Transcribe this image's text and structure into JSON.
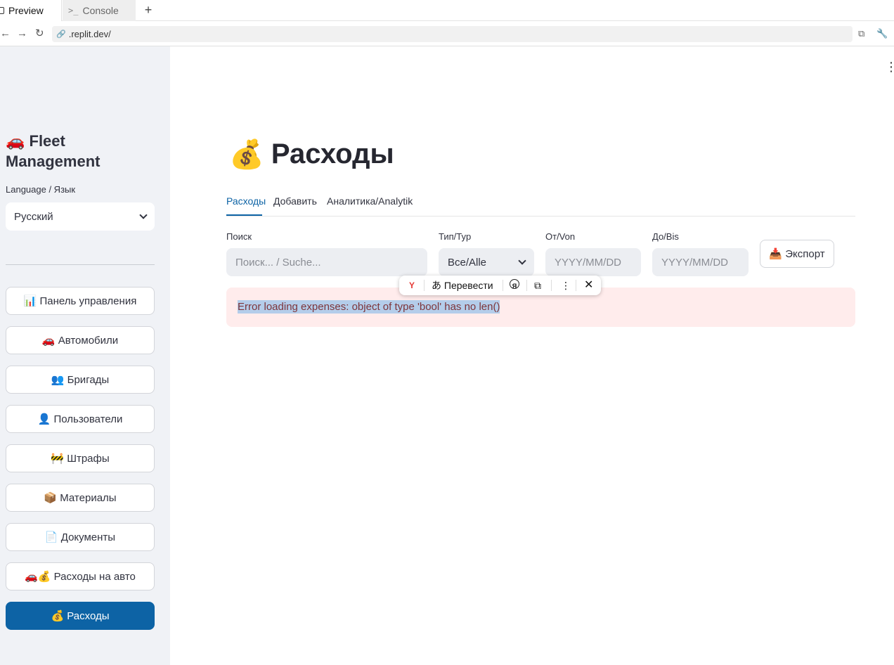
{
  "browser": {
    "tabs": [
      {
        "label": "Preview",
        "icon": "preview-icon"
      },
      {
        "label": "Console",
        "icon": "console-icon"
      }
    ],
    "new_tab": "+",
    "url": ".replit.dev/"
  },
  "sidebar": {
    "app_title": "🚗 Fleet Management",
    "language_label": "Language / Язык",
    "language_value": "Русский",
    "items": [
      {
        "label": "📊 Панель управления"
      },
      {
        "label": "🚗 Автомобили"
      },
      {
        "label": "👥 Бригады"
      },
      {
        "label": "👤 Пользователи"
      },
      {
        "label": "🚧 Штрафы"
      },
      {
        "label": "📦 Материалы"
      },
      {
        "label": "📄 Документы"
      },
      {
        "label": "🚗💰 Расходы на авто"
      },
      {
        "label": "💰 Расходы",
        "active": true
      }
    ]
  },
  "main": {
    "title_emoji": "💰",
    "title": "Расходы",
    "tabs": [
      {
        "label": "Расходы",
        "active": true
      },
      {
        "label": "Добавить"
      },
      {
        "label": "Аналитика/Analytik"
      }
    ],
    "filters": {
      "search_label": "Поиск",
      "search_placeholder": "Поиск... / Suche...",
      "type_label": "Тип/Typ",
      "type_value": "Все/Alle",
      "from_label": "От/Von",
      "from_placeholder": "YYYY/MM/DD",
      "to_label": "До/Bis",
      "to_placeholder": "YYYY/MM/DD",
      "export_label": "📥 Экспорт"
    },
    "error": "Error loading expenses: object of type 'bool' has no len()"
  },
  "translate_popup": {
    "translate_label": "Перевести"
  },
  "colors": {
    "accent": "#0d63a5",
    "sidebar_bg": "#f0f2f6",
    "error_bg": "#ffecec",
    "error_text": "#7d353b"
  }
}
